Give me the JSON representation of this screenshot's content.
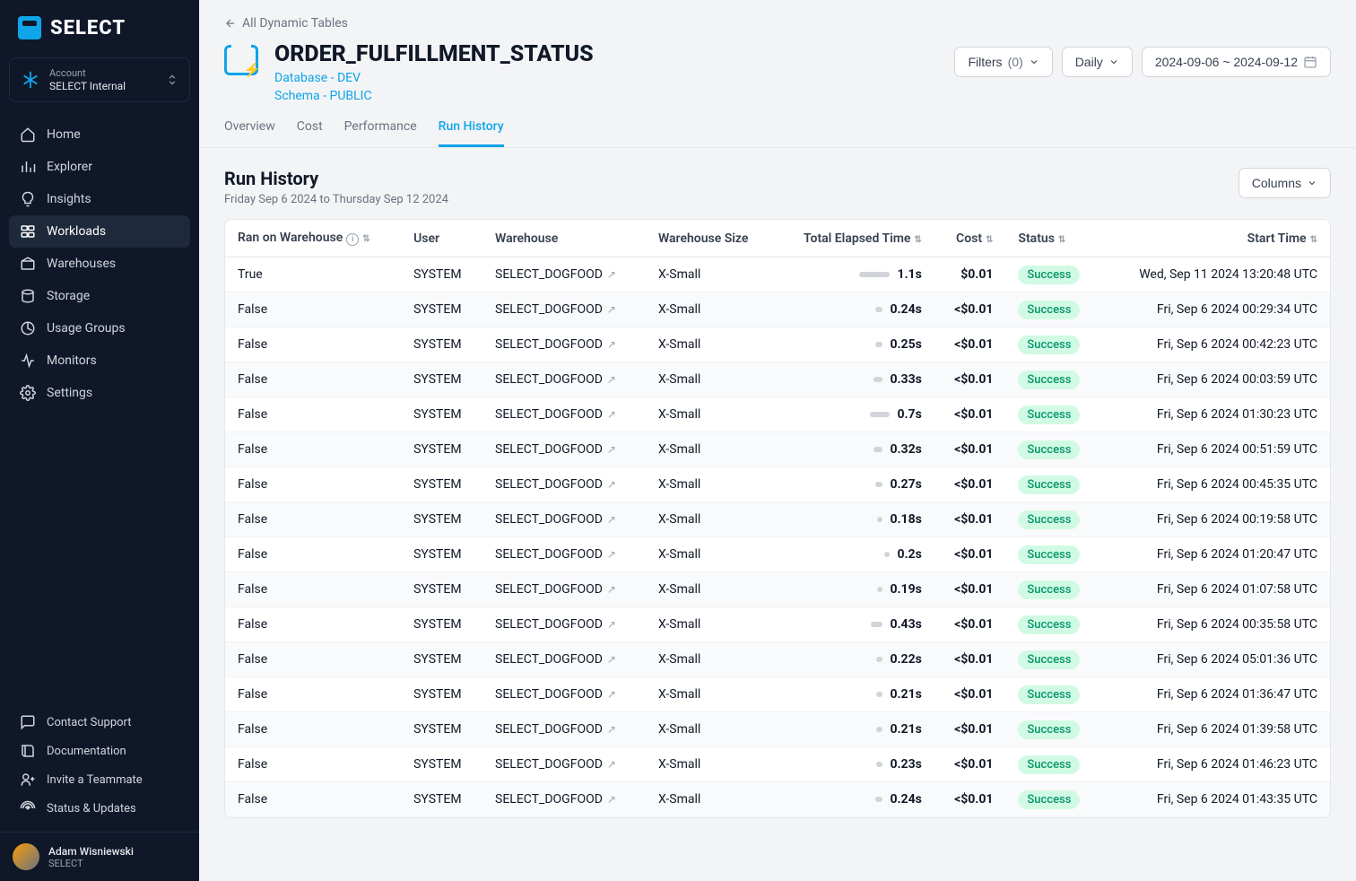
{
  "logo": "SELECT",
  "account": {
    "label": "Account",
    "name": "SELECT Internal"
  },
  "nav": [
    {
      "icon": "home",
      "label": "Home"
    },
    {
      "icon": "explorer",
      "label": "Explorer"
    },
    {
      "icon": "insights",
      "label": "Insights"
    },
    {
      "icon": "workloads",
      "label": "Workloads",
      "active": true
    },
    {
      "icon": "warehouses",
      "label": "Warehouses"
    },
    {
      "icon": "storage",
      "label": "Storage"
    },
    {
      "icon": "usage",
      "label": "Usage Groups"
    },
    {
      "icon": "monitors",
      "label": "Monitors"
    },
    {
      "icon": "settings",
      "label": "Settings"
    }
  ],
  "footer_nav": [
    {
      "icon": "support",
      "label": "Contact Support"
    },
    {
      "icon": "docs",
      "label": "Documentation"
    },
    {
      "icon": "invite",
      "label": "Invite a Teammate"
    },
    {
      "icon": "status",
      "label": "Status & Updates"
    }
  ],
  "user": {
    "name": "Adam Wisniewski",
    "org": "SELECT"
  },
  "breadcrumb": "All Dynamic Tables",
  "title": "ORDER_FULFILLMENT_STATUS",
  "subtitle1": "Database - DEV",
  "subtitle2": "Schema - PUBLIC",
  "filters_label": "Filters",
  "filters_count": "(0)",
  "granularity": "Daily",
  "date_range": "2024-09-06 ~ 2024-09-12",
  "tabs": [
    "Overview",
    "Cost",
    "Performance",
    "Run History"
  ],
  "active_tab": "Run History",
  "section_title": "Run History",
  "section_subtitle": "Friday Sep 6 2024 to Thursday Sep 12 2024",
  "columns_btn": "Columns",
  "columns": {
    "ran": "Ran on Warehouse",
    "user": "User",
    "warehouse": "Warehouse",
    "size": "Warehouse Size",
    "elapsed": "Total Elapsed Time",
    "cost": "Cost",
    "status": "Status",
    "start": "Start Time"
  },
  "rows": [
    {
      "ran": "True",
      "user": "SYSTEM",
      "warehouse": "SELECT_DOGFOOD",
      "size": "X-Small",
      "elapsed": "1.1s",
      "bar": 34,
      "cost": "$0.01",
      "status": "Success",
      "start": "Wed, Sep 11 2024 13:20:48 UTC"
    },
    {
      "ran": "False",
      "user": "SYSTEM",
      "warehouse": "SELECT_DOGFOOD",
      "size": "X-Small",
      "elapsed": "0.24s",
      "bar": 8,
      "cost": "<$0.01",
      "status": "Success",
      "start": "Fri, Sep 6 2024 00:29:34 UTC"
    },
    {
      "ran": "False",
      "user": "SYSTEM",
      "warehouse": "SELECT_DOGFOOD",
      "size": "X-Small",
      "elapsed": "0.25s",
      "bar": 8,
      "cost": "<$0.01",
      "status": "Success",
      "start": "Fri, Sep 6 2024 00:42:23 UTC"
    },
    {
      "ran": "False",
      "user": "SYSTEM",
      "warehouse": "SELECT_DOGFOOD",
      "size": "X-Small",
      "elapsed": "0.33s",
      "bar": 10,
      "cost": "<$0.01",
      "status": "Success",
      "start": "Fri, Sep 6 2024 00:03:59 UTC"
    },
    {
      "ran": "False",
      "user": "SYSTEM",
      "warehouse": "SELECT_DOGFOOD",
      "size": "X-Small",
      "elapsed": "0.7s",
      "bar": 22,
      "cost": "<$0.01",
      "status": "Success",
      "start": "Fri, Sep 6 2024 01:30:23 UTC"
    },
    {
      "ran": "False",
      "user": "SYSTEM",
      "warehouse": "SELECT_DOGFOOD",
      "size": "X-Small",
      "elapsed": "0.32s",
      "bar": 10,
      "cost": "<$0.01",
      "status": "Success",
      "start": "Fri, Sep 6 2024 00:51:59 UTC"
    },
    {
      "ran": "False",
      "user": "SYSTEM",
      "warehouse": "SELECT_DOGFOOD",
      "size": "X-Small",
      "elapsed": "0.27s",
      "bar": 8,
      "cost": "<$0.01",
      "status": "Success",
      "start": "Fri, Sep 6 2024 00:45:35 UTC"
    },
    {
      "ran": "False",
      "user": "SYSTEM",
      "warehouse": "SELECT_DOGFOOD",
      "size": "X-Small",
      "elapsed": "0.18s",
      "bar": 6,
      "cost": "<$0.01",
      "status": "Success",
      "start": "Fri, Sep 6 2024 00:19:58 UTC"
    },
    {
      "ran": "False",
      "user": "SYSTEM",
      "warehouse": "SELECT_DOGFOOD",
      "size": "X-Small",
      "elapsed": "0.2s",
      "bar": 6,
      "cost": "<$0.01",
      "status": "Success",
      "start": "Fri, Sep 6 2024 01:20:47 UTC"
    },
    {
      "ran": "False",
      "user": "SYSTEM",
      "warehouse": "SELECT_DOGFOOD",
      "size": "X-Small",
      "elapsed": "0.19s",
      "bar": 6,
      "cost": "<$0.01",
      "status": "Success",
      "start": "Fri, Sep 6 2024 01:07:58 UTC"
    },
    {
      "ran": "False",
      "user": "SYSTEM",
      "warehouse": "SELECT_DOGFOOD",
      "size": "X-Small",
      "elapsed": "0.43s",
      "bar": 13,
      "cost": "<$0.01",
      "status": "Success",
      "start": "Fri, Sep 6 2024 00:35:58 UTC"
    },
    {
      "ran": "False",
      "user": "SYSTEM",
      "warehouse": "SELECT_DOGFOOD",
      "size": "X-Small",
      "elapsed": "0.22s",
      "bar": 7,
      "cost": "<$0.01",
      "status": "Success",
      "start": "Fri, Sep 6 2024 05:01:36 UTC"
    },
    {
      "ran": "False",
      "user": "SYSTEM",
      "warehouse": "SELECT_DOGFOOD",
      "size": "X-Small",
      "elapsed": "0.21s",
      "bar": 7,
      "cost": "<$0.01",
      "status": "Success",
      "start": "Fri, Sep 6 2024 01:36:47 UTC"
    },
    {
      "ran": "False",
      "user": "SYSTEM",
      "warehouse": "SELECT_DOGFOOD",
      "size": "X-Small",
      "elapsed": "0.21s",
      "bar": 7,
      "cost": "<$0.01",
      "status": "Success",
      "start": "Fri, Sep 6 2024 01:39:58 UTC"
    },
    {
      "ran": "False",
      "user": "SYSTEM",
      "warehouse": "SELECT_DOGFOOD",
      "size": "X-Small",
      "elapsed": "0.23s",
      "bar": 7,
      "cost": "<$0.01",
      "status": "Success",
      "start": "Fri, Sep 6 2024 01:46:23 UTC"
    },
    {
      "ran": "False",
      "user": "SYSTEM",
      "warehouse": "SELECT_DOGFOOD",
      "size": "X-Small",
      "elapsed": "0.24s",
      "bar": 8,
      "cost": "<$0.01",
      "status": "Success",
      "start": "Fri, Sep 6 2024 01:43:35 UTC"
    }
  ]
}
